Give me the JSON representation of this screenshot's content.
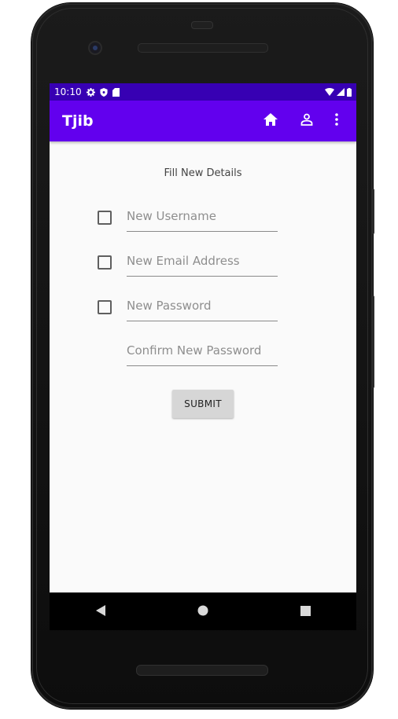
{
  "status_bar": {
    "time": "10:10",
    "icons": [
      "gear-icon",
      "shield-icon",
      "sd-card-icon"
    ],
    "right_icons": [
      "wifi-icon",
      "cell-signal-icon",
      "battery-icon"
    ]
  },
  "app_bar": {
    "title": "Tjib",
    "actions": [
      "home-icon",
      "person-icon",
      "overflow-menu-icon"
    ]
  },
  "form": {
    "title": "Fill New Details",
    "fields": [
      {
        "placeholder": "New Username",
        "has_checkbox": true
      },
      {
        "placeholder": "New Email Address",
        "has_checkbox": true
      },
      {
        "placeholder": "New Password",
        "has_checkbox": true
      },
      {
        "placeholder": "Confirm New Password",
        "has_checkbox": false
      }
    ],
    "submit_label": "SUBMIT"
  },
  "nav_bar": {
    "buttons": [
      "back-icon",
      "home-circle-icon",
      "recents-icon"
    ]
  },
  "colors": {
    "status_bar": "#3700b3",
    "app_bar": "#6200ee",
    "background": "#fafafa",
    "button": "#d6d6d6"
  }
}
